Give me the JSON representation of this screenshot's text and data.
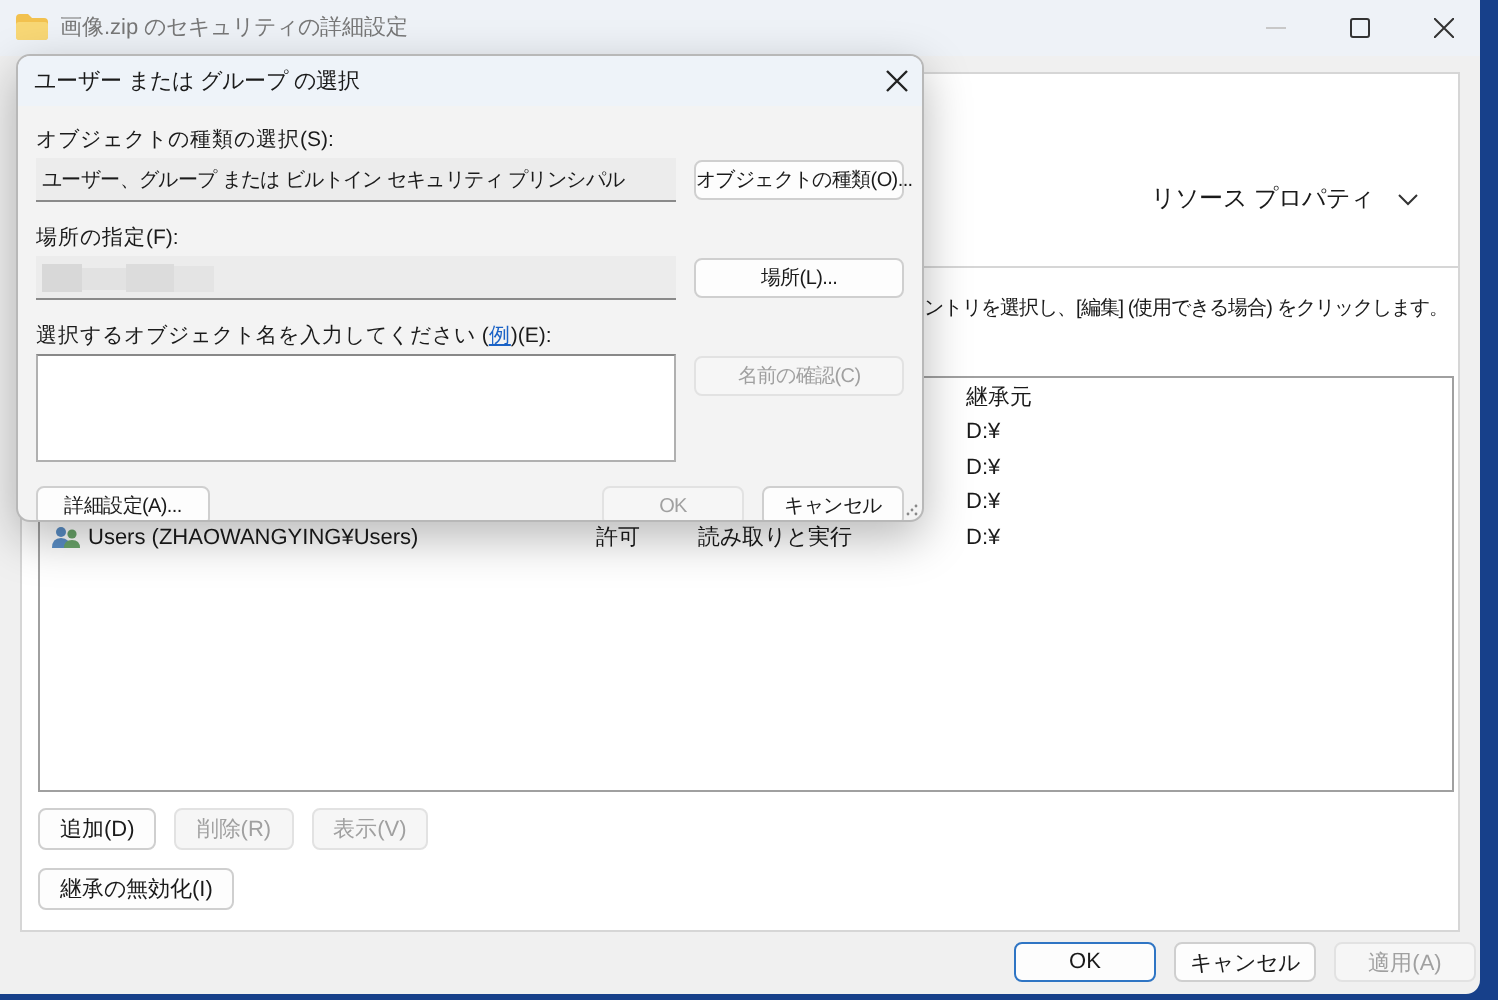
{
  "window": {
    "title": "画像.zip のセキュリティの詳細設定"
  },
  "resource_properties": "リソース プロパティ",
  "instruction": "ントリを選択し、[編集] (使用できる場合) をクリックします。",
  "table": {
    "columns": [
      {
        "label": "継承元"
      }
    ],
    "rows": [
      {
        "inherited_from": "D:¥"
      },
      {
        "inherited_from": "D:¥"
      },
      {
        "inherited_from": "D:¥"
      },
      {
        "name": "Users (ZHAOWANGYING¥Users)",
        "type": "許可",
        "access": "読み取りと実行",
        "inherited_from": "D:¥"
      }
    ]
  },
  "list_buttons": [
    {
      "label": "追加(D)",
      "disabled": false
    },
    {
      "label": "削除(R)",
      "disabled": true
    },
    {
      "label": "表示(V)",
      "disabled": true
    }
  ],
  "inheritance_button": "継承の無効化(I)",
  "footer_buttons": [
    {
      "label": "OK",
      "disabled": false,
      "default": true
    },
    {
      "label": "キャンセル",
      "disabled": false,
      "default": false
    },
    {
      "label": "適用(A)",
      "disabled": true,
      "default": false
    }
  ],
  "dialog": {
    "title": "ユーザー または グループ の選択",
    "object_type_label": "オブジェクトの種類の選択(S):",
    "object_type_value": "ユーザー、グループ または ビルトイン セキュリティ プリンシパル",
    "object_type_button": "オブジェクトの種類(O)...",
    "location_label": "場所の指定(F):",
    "location_button": "場所(L)...",
    "names_label": {
      "before": "選択するオブジェクト名を入力してください (",
      "link": "例",
      "after": ")(E):"
    },
    "buttons": [
      {
        "kind": "check",
        "label": "名前の確認(C)",
        "disabled": true
      },
      {
        "kind": "advanced",
        "label": "詳細設定(A)...",
        "disabled": false
      },
      {
        "kind": "ok",
        "label": "OK",
        "disabled": true
      },
      {
        "kind": "cancel",
        "label": "キャンセル",
        "disabled": false
      }
    ]
  }
}
